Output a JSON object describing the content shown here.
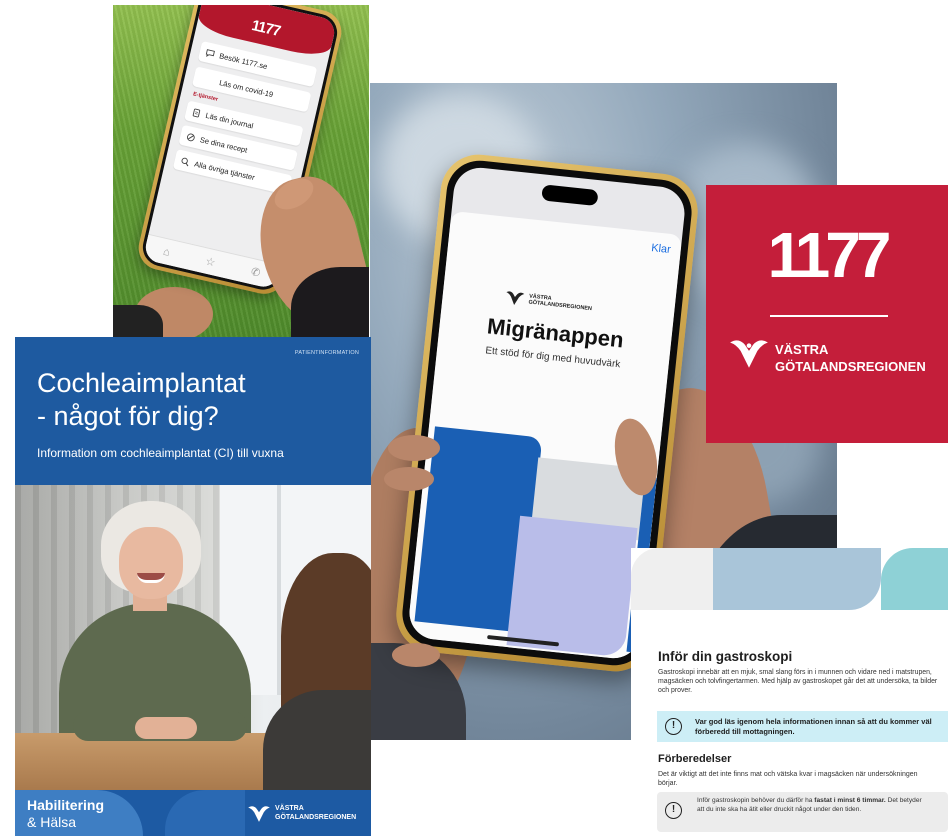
{
  "app_phone": {
    "app_name": "1177",
    "menu": [
      {
        "label": "Besök 1177.se",
        "icon": "chat-icon"
      },
      {
        "label": "Läs om covid-19"
      }
    ],
    "section_label": "E-tjänster",
    "services": [
      {
        "label": "Läs din journal",
        "icon": "journal-icon"
      },
      {
        "label": "Se dina recept",
        "icon": "prescription-icon"
      },
      {
        "label": "Alla övriga tjänster",
        "icon": "search-icon"
      }
    ],
    "tab_icons": [
      "home-icon",
      "star-icon",
      "phone-icon"
    ],
    "header_color": "#b3172c"
  },
  "migraine_phone": {
    "done_label": "Klar",
    "logo_line1": "VÄSTRA",
    "logo_line2": "GÖTALANDSREGIONEN",
    "title": "Migränappen",
    "subtitle": "Ett stöd för dig med huvudvärk",
    "accent_color": "#1a5fb4"
  },
  "brand_card": {
    "number": "1177",
    "logo_line1": "VÄSTRA",
    "logo_line2": "GÖTALANDSREGIONEN",
    "background_color": "#c41e3a"
  },
  "brochure": {
    "kicker": "PATIENTINFORMATION",
    "title_line1": "Cochleaimplantat",
    "title_line2": "- något för dig?",
    "subtitle": "Information om cochleaimplantat (CI) till vuxna",
    "footer_line1": "Habilitering",
    "footer_line2": "& Hälsa",
    "logo_line1": "VÄSTRA",
    "logo_line2": "GÖTALANDSREGIONEN",
    "color": "#1e5aa0"
  },
  "leaflet": {
    "title": "Inför din gastroskopi",
    "intro": "Gastroskopi innebär att en mjuk, smal slang förs in i munnen och vidare ned i matstrupen, magsäcken och tolvfingertarmen. Med hjälp av gastroskopet går det att undersöka, ta bilder och prover.",
    "notice_icon": "!",
    "notice": "Var god läs igenom hela informationen innan så att du kommer väl förberedd till mottagningen.",
    "section_title": "Förberedelser",
    "section_text": "Det är viktigt att det inte finns mat och vätska kvar i magsäcken när undersökningen börjar.",
    "fasting_before": "Inför gastroskopin behöver du därför ha ",
    "fasting_bold": "fastat i minst 6 timmar.",
    "fasting_after": " Det betyder att du inte ska ha ätit eller druckit något under den tiden.",
    "notice_color": "#cdeef6"
  }
}
